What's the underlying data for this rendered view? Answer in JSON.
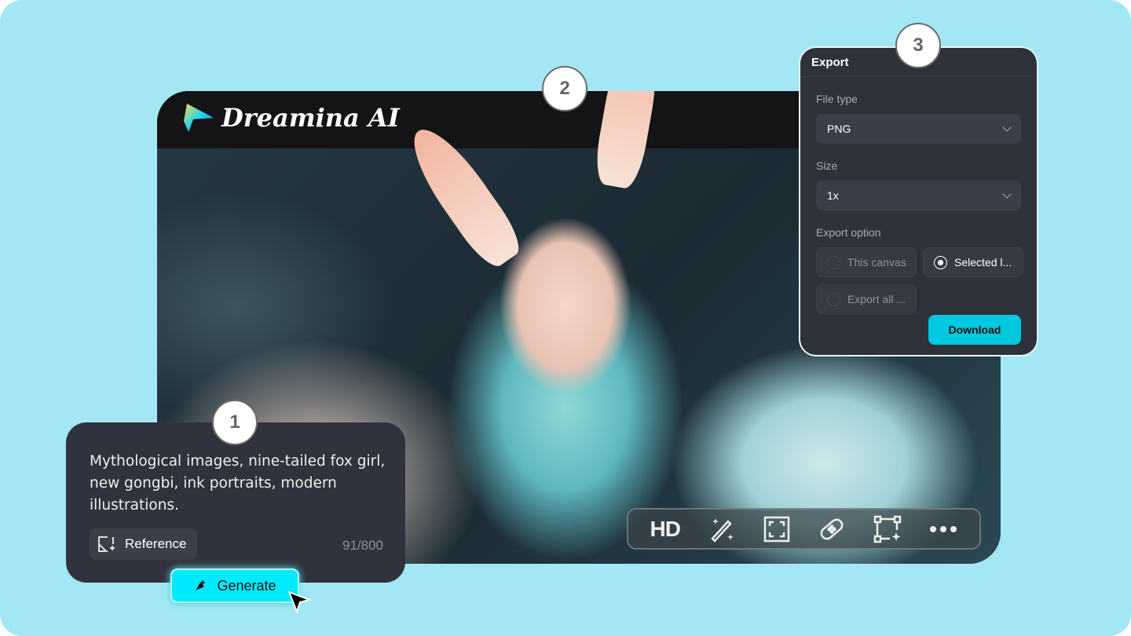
{
  "brand": {
    "name": "Dreamina AI"
  },
  "badges": [
    "1",
    "2",
    "3"
  ],
  "export_panel": {
    "title": "Export",
    "file_type_label": "File type",
    "file_type_value": "PNG",
    "size_label": "Size",
    "size_value": "1x",
    "export_option_label": "Export option",
    "options": [
      {
        "label": "This canvas",
        "selected": false
      },
      {
        "label": "Selected l...",
        "selected": true
      },
      {
        "label": "Export all ...",
        "selected": false
      }
    ],
    "download_label": "Download"
  },
  "prompt": {
    "text": "Mythological images, nine-tailed fox girl, new gongbi, ink portraits, modern illustrations.",
    "reference_label": "Reference",
    "char_count": "91/800",
    "generate_label": "Generate"
  },
  "toolbar": {
    "hd_label": "HD",
    "icons": [
      "magic-wand-icon",
      "expand-icon",
      "bandage-icon",
      "transform-icon",
      "more-icon"
    ]
  },
  "colors": {
    "background": "#a2e7f3",
    "accent": "#00c8de",
    "generate": "#00eaff",
    "panel": "#2e323b"
  }
}
